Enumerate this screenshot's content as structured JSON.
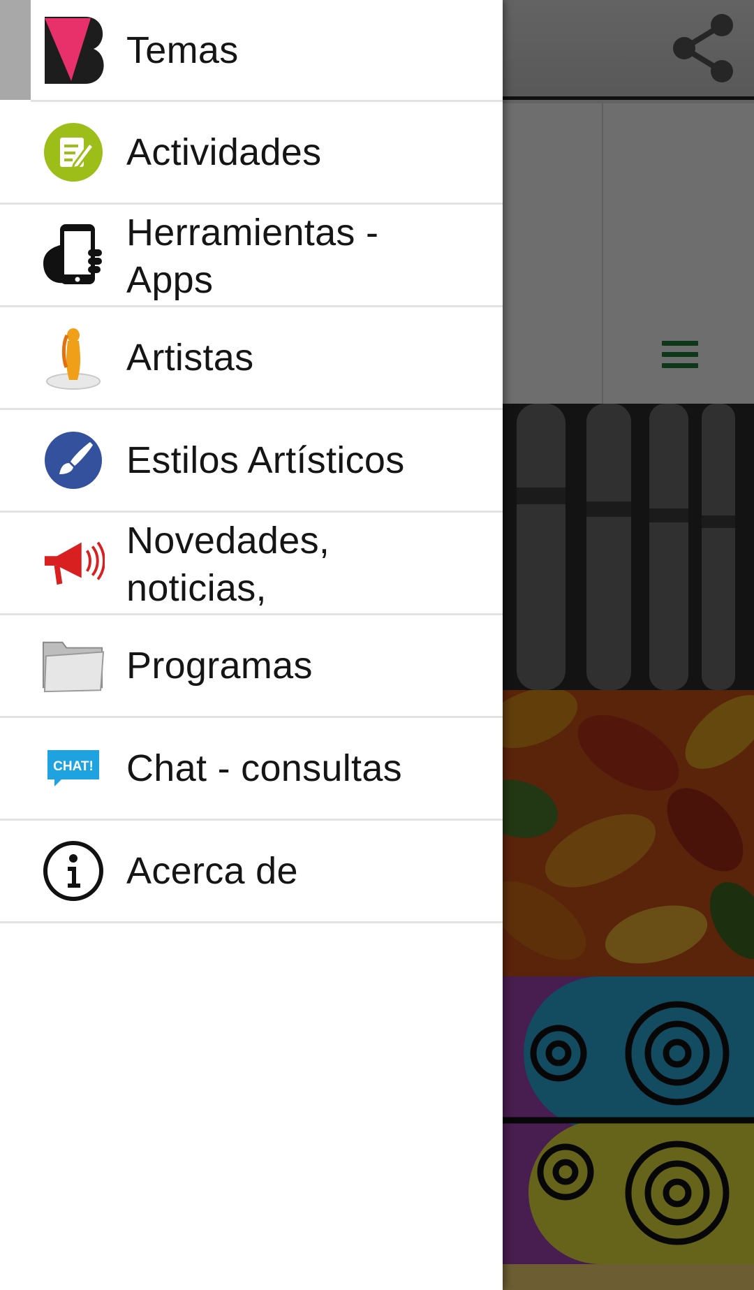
{
  "drawer": {
    "items": [
      {
        "label": "Temas",
        "icon": "temas-logo-icon"
      },
      {
        "label": "Actividades",
        "icon": "notes-icon",
        "color": "#9dbd18"
      },
      {
        "label": "Herramientas - Apps",
        "icon": "phone-hand-icon"
      },
      {
        "label": "Artistas",
        "icon": "venus-statue-icon",
        "color": "#f0a018"
      },
      {
        "label": "Estilos Artísticos",
        "icon": "paintbrush-icon",
        "color": "#34519e"
      },
      {
        "label": "Novedades, noticias,",
        "icon": "megaphone-icon",
        "color": "#d82020"
      },
      {
        "label": "Programas",
        "icon": "folder-icon"
      },
      {
        "label": "Chat - consultas",
        "icon": "chat-icon",
        "color": "#1fa3e0",
        "icon_text": "CHAT!"
      },
      {
        "label": "Acerca de",
        "icon": "info-icon"
      }
    ]
  },
  "background": {
    "toolbar_color": "#d0d0d0",
    "accent": "#1f7a3a"
  }
}
